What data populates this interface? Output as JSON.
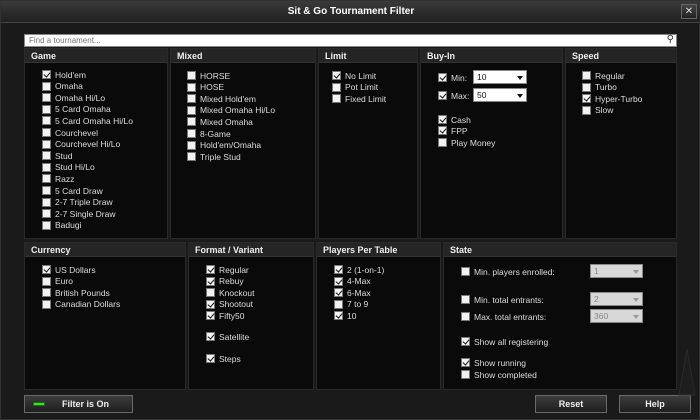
{
  "window": {
    "title": "Sit & Go Tournament Filter",
    "close_glyph": "✕"
  },
  "search": {
    "placeholder": "Find a tournament..."
  },
  "panels": {
    "game": {
      "title": "Game",
      "items": [
        {
          "label": "Hold'em",
          "checked": true
        },
        {
          "label": "Omaha",
          "checked": false
        },
        {
          "label": "Omaha Hi/Lo",
          "checked": false
        },
        {
          "label": "5 Card Omaha",
          "checked": false
        },
        {
          "label": "5 Card Omaha Hi/Lo",
          "checked": false
        },
        {
          "label": "Courchevel",
          "checked": false
        },
        {
          "label": "Courchevel Hi/Lo",
          "checked": false
        },
        {
          "label": "Stud",
          "checked": false
        },
        {
          "label": "Stud Hi/Lo",
          "checked": false
        },
        {
          "label": "Razz",
          "checked": false
        },
        {
          "label": "5 Card Draw",
          "checked": false
        },
        {
          "label": "2-7 Triple Draw",
          "checked": false
        },
        {
          "label": "2-7 Single Draw",
          "checked": false
        },
        {
          "label": "Badugi",
          "checked": false
        }
      ]
    },
    "mixed": {
      "title": "Mixed",
      "items": [
        {
          "label": "HORSE",
          "checked": false
        },
        {
          "label": "HOSE",
          "checked": false
        },
        {
          "label": "Mixed Hold'em",
          "checked": false
        },
        {
          "label": "Mixed Omaha Hi/Lo",
          "checked": false
        },
        {
          "label": "Mixed Omaha",
          "checked": false
        },
        {
          "label": "8-Game",
          "checked": false
        },
        {
          "label": "Hold'em/Omaha",
          "checked": false
        },
        {
          "label": "Triple Stud",
          "checked": false
        }
      ]
    },
    "limit": {
      "title": "Limit",
      "items": [
        {
          "label": "No Limit",
          "checked": true
        },
        {
          "label": "Pot Limit",
          "checked": false
        },
        {
          "label": "Fixed Limit",
          "checked": false
        }
      ]
    },
    "buyin": {
      "title": "Buy-In",
      "min": {
        "label": "Min:",
        "checked": true,
        "value": "10"
      },
      "max": {
        "label": "Max:",
        "checked": true,
        "value": "50"
      },
      "items": [
        {
          "label": "Cash",
          "checked": true
        },
        {
          "label": "FPP",
          "checked": true
        },
        {
          "label": "Play Money",
          "checked": false
        }
      ]
    },
    "speed": {
      "title": "Speed",
      "items": [
        {
          "label": "Regular",
          "checked": false
        },
        {
          "label": "Turbo",
          "checked": false
        },
        {
          "label": "Hyper-Turbo",
          "checked": true
        },
        {
          "label": "Slow",
          "checked": false
        }
      ]
    },
    "currency": {
      "title": "Currency",
      "items": [
        {
          "label": "US Dollars",
          "checked": true
        },
        {
          "label": "Euro",
          "checked": false
        },
        {
          "label": "British Pounds",
          "checked": false
        },
        {
          "label": "Canadian Dollars",
          "checked": false
        }
      ]
    },
    "format": {
      "title": "Format / Variant",
      "items": [
        {
          "label": "Regular",
          "checked": true
        },
        {
          "label": "Rebuy",
          "checked": true
        },
        {
          "label": "Knockout",
          "checked": false
        },
        {
          "label": "Shootout",
          "checked": true
        },
        {
          "label": "Fifty50",
          "checked": true
        },
        {
          "label": "Satellite",
          "checked": true
        },
        {
          "label": "Steps",
          "checked": true
        }
      ]
    },
    "players": {
      "title": "Players Per Table",
      "items": [
        {
          "label": "2 (1-on-1)",
          "checked": true
        },
        {
          "label": "4-Max",
          "checked": true
        },
        {
          "label": "6-Max",
          "checked": true
        },
        {
          "label": "7 to 9",
          "checked": false
        },
        {
          "label": "10",
          "checked": true
        }
      ]
    },
    "state": {
      "title": "State",
      "min_players": {
        "label": "Min. players enrolled:",
        "checked": false,
        "value": "1"
      },
      "min_entrants": {
        "label": "Min. total entrants:",
        "checked": false,
        "value": "2"
      },
      "max_entrants": {
        "label": "Max. total entrants:",
        "checked": false,
        "value": "360"
      },
      "show_registering": {
        "label": "Show all registering",
        "checked": true
      },
      "show_running": {
        "label": "Show running",
        "checked": true
      },
      "show_completed": {
        "label": "Show completed",
        "checked": false
      }
    }
  },
  "buttons": {
    "filter": "Filter is On",
    "reset": "Reset",
    "help": "Help"
  },
  "colors": {
    "filter_led": "#3ce02c"
  }
}
